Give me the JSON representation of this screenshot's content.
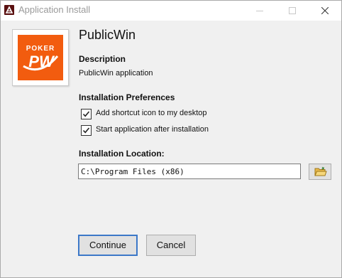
{
  "window": {
    "title": "Application Install"
  },
  "app": {
    "name": "PublicWin",
    "logo": {
      "top_text": "POKER",
      "mark_text": "PW",
      "brand_color": "#f25c0f"
    }
  },
  "description": {
    "heading": "Description",
    "text": "PublicWin application"
  },
  "preferences": {
    "heading": "Installation Preferences",
    "options": [
      {
        "label": "Add shortcut icon to my desktop",
        "checked": true
      },
      {
        "label": "Start application after installation",
        "checked": true
      }
    ]
  },
  "location": {
    "heading": "Installation Location:",
    "path": "C:\\Program Files (x86)",
    "browse_icon": "folder-open-icon"
  },
  "buttons": {
    "continue": "Continue",
    "cancel": "Cancel"
  },
  "colors": {
    "focus_border": "#3c78c8",
    "title_text": "#9a9a9a"
  }
}
